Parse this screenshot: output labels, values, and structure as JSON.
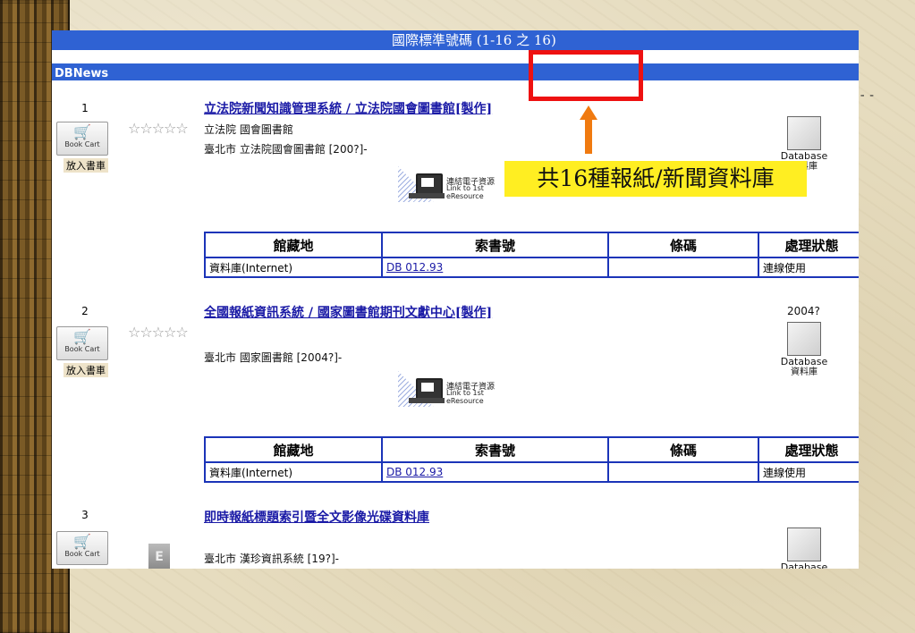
{
  "header": {
    "title": "國際標準號碼 (1-16 之 16)",
    "db_label": "DBNews"
  },
  "callout": "共16種報紙/新聞資料庫",
  "labels": {
    "cart_en": "Book Cart",
    "cart_zh": "放入書車",
    "stars": "☆☆☆☆☆",
    "db_en": "Database",
    "db_zh": "資料庫",
    "eres_zh": "連結電子資源",
    "eres_en": "Link to 1st eResource",
    "col_location": "館藏地",
    "col_callno": "索書號",
    "col_barcode": "條碼",
    "col_status": "處理狀態"
  },
  "records": [
    {
      "num": "1",
      "title": "立法院新聞知識管理系統 / 立法院國會圖書館[製作]",
      "line1": "立法院 國會圖書館",
      "line2": "臺北市 立法院國會圖書館 [200?]-",
      "year": "",
      "holding": {
        "location": "資料庫(Internet)",
        "callno": "DB 012.93",
        "barcode": "",
        "status": "連線使用"
      }
    },
    {
      "num": "2",
      "title": "全國報紙資訊系統 / 國家圖書館期刊文獻中心[製作]",
      "line1": "",
      "line2": "臺北市 國家圖書館 [2004?]-",
      "year": "2004?",
      "holding": {
        "location": "資料庫(Internet)",
        "callno": "DB 012.93",
        "barcode": "",
        "status": "連線使用"
      }
    },
    {
      "num": "3",
      "title": "即時報紙標題索引暨全文影像光碟資料庫",
      "line1": "",
      "line2": "臺北市 漢珍資訊系統 [19?]-",
      "year": "",
      "ebook": "E"
    }
  ],
  "colors": {
    "bar": "#2f62d3",
    "link": "#1a1aa6",
    "highlight": "#ffee22",
    "red_box": "#ee1111",
    "arrow": "#f07a10"
  }
}
